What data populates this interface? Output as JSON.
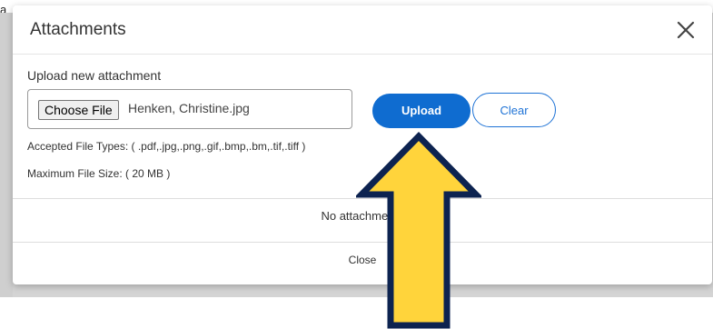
{
  "background": {
    "peek_text": "a"
  },
  "modal": {
    "title": "Attachments",
    "close_icon": "close-icon",
    "upload_section_label": "Upload new attachment",
    "file_input": {
      "choose_label": "Choose File",
      "selected_file": "Henken, Christine.jpg"
    },
    "upload_label": "Upload",
    "clear_label": "Clear",
    "accepted_types": "Accepted File Types: ( .pdf,.jpg,.png,.gif,.bmp,.bm,.tif,.tiff )",
    "max_size": "Maximum File Size: ( 20 MB )",
    "empty_message": "No attachments",
    "close_label": "Close"
  },
  "annotation": {
    "icon": "up-arrow-icon",
    "fill_color": "#ffd43b",
    "stroke_color": "#0d2350"
  },
  "colors": {
    "primary": "#0f6cd0",
    "backdrop": "#d4d4d4"
  }
}
